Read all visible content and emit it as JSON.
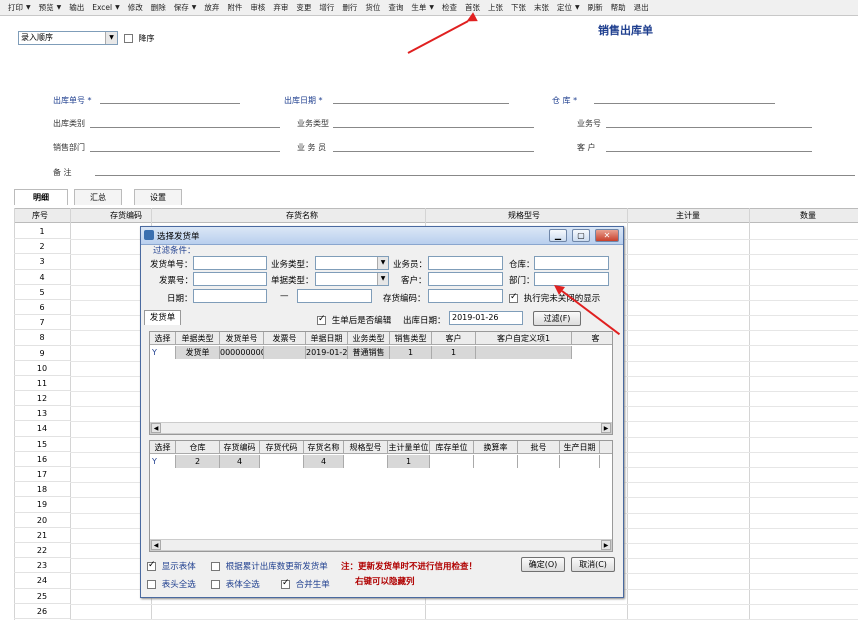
{
  "toolbar": {
    "items": [
      {
        "label": "打印",
        "dropdown": true
      },
      {
        "label": "预览",
        "dropdown": true
      },
      {
        "label": "输出",
        "dropdown": false
      },
      {
        "label": "Excel",
        "dropdown": true
      },
      {
        "label": "修改",
        "dropdown": false
      },
      {
        "label": "删除",
        "dropdown": false
      },
      {
        "label": "保存",
        "dropdown": true
      },
      {
        "label": "放弃",
        "dropdown": false
      },
      {
        "label": "附件",
        "dropdown": false
      },
      {
        "label": "审核",
        "dropdown": false
      },
      {
        "label": "弃审",
        "dropdown": false
      },
      {
        "label": "变更",
        "dropdown": false
      },
      {
        "label": "增行",
        "dropdown": false
      },
      {
        "label": "删行",
        "dropdown": false
      },
      {
        "label": "货位",
        "dropdown": false
      },
      {
        "label": "查询",
        "dropdown": false
      },
      {
        "label": "生单",
        "dropdown": true
      },
      {
        "label": "检查",
        "dropdown": false
      },
      {
        "label": "首张",
        "dropdown": false
      },
      {
        "label": "上张",
        "dropdown": false
      },
      {
        "label": "下张",
        "dropdown": false
      },
      {
        "label": "末张",
        "dropdown": false
      },
      {
        "label": "定位",
        "dropdown": true
      },
      {
        "label": "刷新",
        "dropdown": false
      },
      {
        "label": "帮助",
        "dropdown": false
      },
      {
        "label": "退出",
        "dropdown": false
      }
    ]
  },
  "form": {
    "sort_select": "录入顺序",
    "desc_label": "降序",
    "title": "销售出库单",
    "fields": {
      "out_no": "出库单号 *",
      "out_date": "出库日期 *",
      "warehouse": "仓  库 *",
      "out_type": "出库类别",
      "biz_type": "业务类型",
      "biz_no": "业务号",
      "dept": "销售部门",
      "clerk": "业 务 员",
      "customer": "客  户",
      "remark": "备  注"
    },
    "tabs": [
      "明细",
      "汇总",
      "设置"
    ]
  },
  "grid": {
    "columns": [
      "序号",
      "存货编码",
      "存货名称",
      "规格型号",
      "主计量",
      "数量"
    ],
    "row_numbers": [
      "1",
      "2",
      "3",
      "4",
      "5",
      "6",
      "7",
      "8",
      "9",
      "10",
      "11",
      "12",
      "13",
      "14",
      "15",
      "16",
      "17",
      "18",
      "19",
      "20",
      "21",
      "22",
      "23",
      "24",
      "25",
      "26"
    ]
  },
  "dialog": {
    "title": "选择发货单",
    "filter_legend": "过滤条件：",
    "filters": {
      "doc_no": "发货单号：",
      "biz_type": "业务类型：",
      "clerk": "业务员：",
      "warehouse": "仓库：",
      "invoice_no": "发票号：",
      "doc_type": "单据类型：",
      "customer": "客户：",
      "dept": "部门：",
      "date": "日期：",
      "date_sep": "—",
      "inv_code": "存货编码：",
      "show_closed": "执行完未关闭的显示"
    },
    "tab": "发货单",
    "gen_edit": "生单后是否编辑",
    "out_date_label": "出库日期：",
    "out_date_value": "2019-01-26",
    "filter_button": "过滤(F)",
    "upper_grid": {
      "columns": [
        "选择",
        "单据类型",
        "发货单号",
        "发票号",
        "单据日期",
        "业务类型",
        "销售类型",
        "客户",
        "客户自定义项1",
        "客"
      ],
      "rows": [
        {
          "select": "Y",
          "doc_type": "发货单",
          "doc_no": "0000000001",
          "invoice": "",
          "date": "2019-01-2",
          "biz_type": "普通销售",
          "sale_type": "1",
          "customer": "1",
          "custom1": ""
        }
      ]
    },
    "lower_grid": {
      "columns": [
        "选择",
        "仓库",
        "存货编码",
        "存货代码",
        "存货名称",
        "规格型号",
        "主计量单位",
        "库存单位",
        "换算率",
        "批号",
        "生产日期"
      ],
      "rows": [
        {
          "select": "Y",
          "warehouse": "2",
          "inv_code": "4",
          "inv_alias": "",
          "inv_name": "4",
          "spec": "",
          "unit": "1",
          "stock_unit": "",
          "rate": "",
          "batch": "",
          "prod_date": ""
        }
      ]
    },
    "show_body": "显示表体",
    "by_cumulative": "根据累计出库数更新发货单",
    "note": "注：更新发货单时不进行信用检查！",
    "note2": "右键可以隐藏列",
    "ok_button": "确定(O)",
    "cancel_button": "取消(C)",
    "select_all_head": "表头全选",
    "select_all_body": "表体全选",
    "merge_gen": "合并生单"
  },
  "colors": {
    "accent": "#1f3f8f",
    "annotation_arrow": "#e02020"
  }
}
